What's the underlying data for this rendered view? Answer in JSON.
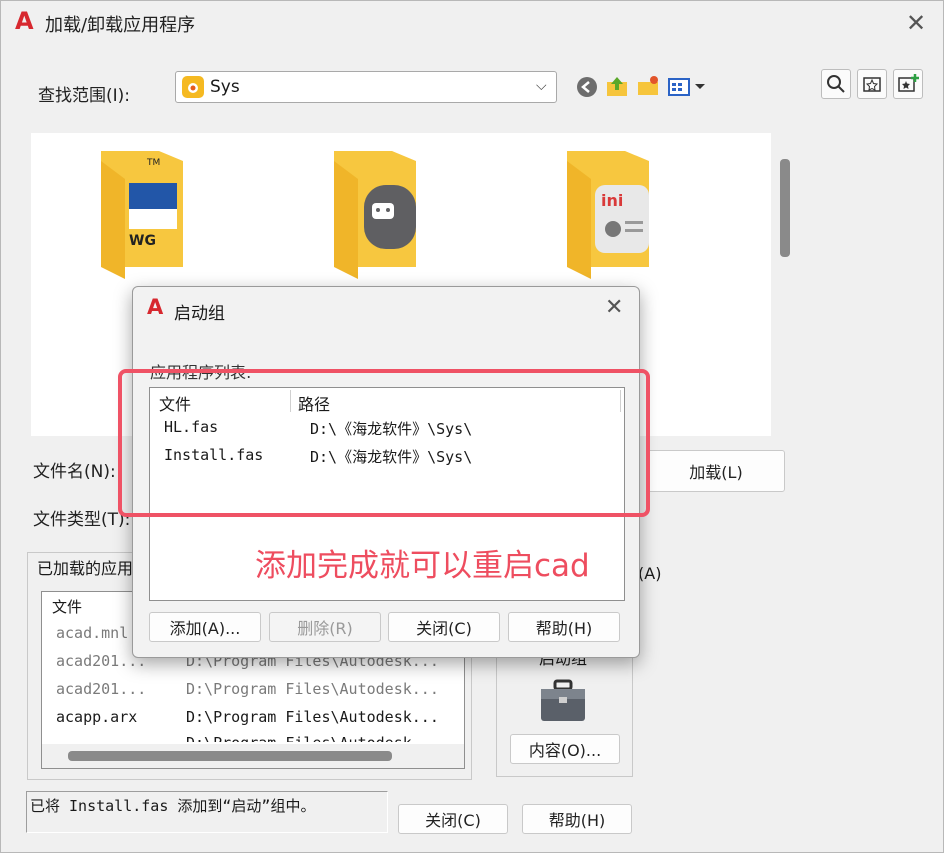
{
  "window": {
    "title": "加载/卸载应用程序",
    "logo_letter": "A"
  },
  "lookin": {
    "label": "查找范围(I):",
    "value": "Sys"
  },
  "folders": [
    {
      "name": "dwg-folder",
      "badge": "WG"
    },
    {
      "name": "app-folder",
      "badge": ""
    },
    {
      "name": "ini-folder",
      "badge": "ini"
    }
  ],
  "filename_label": "文件名(N):",
  "filetype_label": "文件类型(T):",
  "load_button": "加载(L)",
  "loaded_group_label": "已加载的应用",
  "loaded_list": {
    "col_file": "文件",
    "rows": [
      {
        "file": "acad.mnl",
        "path": "",
        "grey": true
      },
      {
        "file": "acad201...",
        "path": "D:\\Program Files\\Autodesk...",
        "grey": true
      },
      {
        "file": "acad201...",
        "path": "D:\\Program Files\\Autodesk...",
        "grey": true
      },
      {
        "file": "acapp.arx",
        "path": "D:\\Program Files\\Autodesk...",
        "grey": false
      },
      {
        "file": "",
        "path": "D:\\Program Files\\Autodesk...",
        "grey": false
      }
    ]
  },
  "right_panel": {
    "a_label": "(A)",
    "startup_label": "启动组",
    "contents_button": "内容(O)..."
  },
  "status_text": "已将 Install.fas 添加到“启动”组中。",
  "bottom_buttons": {
    "close": "关闭(C)",
    "help": "帮助(H)"
  },
  "dialog": {
    "title": "启动组",
    "logo_letter": "A",
    "list_label": "应用程序列表:",
    "col_file": "文件",
    "col_path": "路径",
    "rows": [
      {
        "file": "HL.fas",
        "path": "D:\\《海龙软件》\\Sys\\"
      },
      {
        "file": "Install.fas",
        "path": "D:\\《海龙软件》\\Sys\\"
      }
    ],
    "buttons": {
      "add": "添加(A)...",
      "remove": "删除(R)",
      "close": "关闭(C)",
      "help": "帮助(H)"
    }
  },
  "annotation": "添加完成就可以重启cad",
  "colors": {
    "accent_red": "#d7282f",
    "annotation": "#ee4d5f",
    "folder": "#f6c53c"
  }
}
